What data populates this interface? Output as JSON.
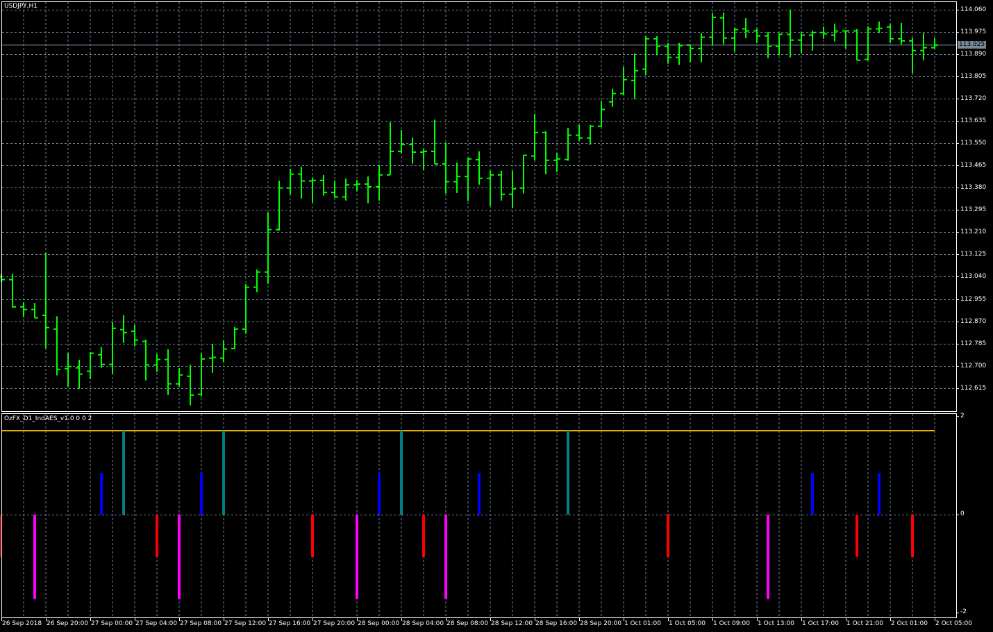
{
  "header": {
    "symbol_label": "USDJPY,H1"
  },
  "indicator": {
    "label": "OzFX_D1_IndAES_v1.0 0 0 2",
    "axis_labels": [
      "2",
      "0",
      "-2"
    ],
    "axis_values": [
      2,
      0,
      -2
    ],
    "level_line": 1.71,
    "colors": {
      "level": "#FFC000",
      "teal": "#008080",
      "blue": "#0000FF",
      "red": "#FF0000",
      "magenta": "#FF00FF"
    },
    "bars": [
      {
        "i": 0,
        "v": -0.86,
        "color": "red"
      },
      {
        "i": 3,
        "v": -1.72,
        "color": "magenta"
      },
      {
        "i": 9,
        "v": 0.85,
        "color": "blue"
      },
      {
        "i": 11,
        "v": 1.71,
        "color": "teal"
      },
      {
        "i": 14,
        "v": -0.86,
        "color": "red"
      },
      {
        "i": 16,
        "v": -1.72,
        "color": "magenta"
      },
      {
        "i": 18,
        "v": 0.85,
        "color": "blue"
      },
      {
        "i": 20,
        "v": 1.71,
        "color": "teal"
      },
      {
        "i": 28,
        "v": -0.86,
        "color": "red"
      },
      {
        "i": 32,
        "v": -1.72,
        "color": "magenta"
      },
      {
        "i": 34,
        "v": 0.85,
        "color": "blue"
      },
      {
        "i": 36,
        "v": 1.71,
        "color": "teal"
      },
      {
        "i": 38,
        "v": -0.86,
        "color": "red"
      },
      {
        "i": 40,
        "v": -1.72,
        "color": "magenta"
      },
      {
        "i": 43,
        "v": 0.85,
        "color": "blue"
      },
      {
        "i": 51,
        "v": 1.71,
        "color": "teal"
      },
      {
        "i": 60,
        "v": -0.86,
        "color": "red"
      },
      {
        "i": 69,
        "v": -1.72,
        "color": "magenta"
      },
      {
        "i": 73,
        "v": 0.85,
        "color": "blue"
      },
      {
        "i": 77,
        "v": -0.86,
        "color": "red"
      },
      {
        "i": 79,
        "v": 0.85,
        "color": "blue"
      },
      {
        "i": 82,
        "v": -0.86,
        "color": "red"
      }
    ]
  },
  "price_axis": {
    "labels": [
      "114.060",
      "113.975",
      "113.890",
      "113.805",
      "113.720",
      "113.635",
      "113.550",
      "113.465",
      "113.380",
      "113.295",
      "113.210",
      "113.125",
      "113.040",
      "112.955",
      "112.870",
      "112.785",
      "112.700",
      "112.615"
    ],
    "current_price": "113.925"
  },
  "time_axis": {
    "labels": [
      "26 Sep 2018",
      "26 Sep 20:00",
      "27 Sep 00:00",
      "27 Sep 04:00",
      "27 Sep 08:00",
      "27 Sep 12:00",
      "27 Sep 16:00",
      "27 Sep 20:00",
      "28 Sep 00:00",
      "28 Sep 04:00",
      "28 Sep 08:00",
      "28 Sep 12:00",
      "28 Sep 16:00",
      "28 Sep 20:00",
      "1 Oct 01:00",
      "1 Oct 05:00",
      "1 Oct 09:00",
      "1 Oct 13:00",
      "1 Oct 17:00",
      "1 Oct 21:00",
      "2 Oct 01:00",
      "2 Oct 05:00"
    ]
  },
  "colors": {
    "bars": "#00FF00",
    "grid": "#778899",
    "frame": "#FFFFFF",
    "price_line": "#778899"
  },
  "chart_data": {
    "type": "ohlc",
    "title": "USDJPY,H1",
    "ylim": [
      112.59,
      114.07
    ],
    "bars_ohlc": [
      [
        113.04,
        113.052,
        113.02,
        113.029
      ],
      [
        113.029,
        113.052,
        112.922,
        112.925
      ],
      [
        112.925,
        112.943,
        112.885,
        112.915
      ],
      [
        112.915,
        112.94,
        112.882,
        112.883
      ],
      [
        112.893,
        113.131,
        112.766,
        112.846
      ],
      [
        112.84,
        112.889,
        112.663,
        112.686
      ],
      [
        112.689,
        112.749,
        112.62,
        112.697
      ],
      [
        112.692,
        112.723,
        112.612,
        112.668
      ],
      [
        112.679,
        112.752,
        112.649,
        112.748
      ],
      [
        112.742,
        112.771,
        112.692,
        112.705
      ],
      [
        112.705,
        112.868,
        112.668,
        112.843
      ],
      [
        112.838,
        112.893,
        112.787,
        112.827
      ],
      [
        112.832,
        112.856,
        112.774,
        112.798
      ],
      [
        112.793,
        112.8,
        112.644,
        112.703
      ],
      [
        112.703,
        112.744,
        112.676,
        112.724
      ],
      [
        112.724,
        112.763,
        112.588,
        112.631
      ],
      [
        112.631,
        112.691,
        112.62,
        112.665
      ],
      [
        112.66,
        112.704,
        112.549,
        112.588
      ],
      [
        112.591,
        112.747,
        112.583,
        112.726
      ],
      [
        112.729,
        112.784,
        112.673,
        112.732
      ],
      [
        112.729,
        112.797,
        112.713,
        112.764
      ],
      [
        112.766,
        112.848,
        112.764,
        112.84
      ],
      [
        112.84,
        113.012,
        112.822,
        113.0
      ],
      [
        113.0,
        113.068,
        112.981,
        113.058
      ],
      [
        113.058,
        113.285,
        113.013,
        113.22
      ],
      [
        113.22,
        113.407,
        113.216,
        113.379
      ],
      [
        113.379,
        113.452,
        113.354,
        113.432
      ],
      [
        113.432,
        113.46,
        113.338,
        113.406
      ],
      [
        113.406,
        113.418,
        113.323,
        113.408
      ],
      [
        113.408,
        113.429,
        113.35,
        113.362
      ],
      [
        113.362,
        113.407,
        113.342,
        113.345
      ],
      [
        113.345,
        113.415,
        113.331,
        113.391
      ],
      [
        113.391,
        113.41,
        113.366,
        113.394
      ],
      [
        113.394,
        113.423,
        113.321,
        113.384
      ],
      [
        113.384,
        113.468,
        113.331,
        113.429
      ],
      [
        113.429,
        113.63,
        113.429,
        113.519
      ],
      [
        113.519,
        113.601,
        113.512,
        113.545
      ],
      [
        113.545,
        113.572,
        113.472,
        113.516
      ],
      [
        113.516,
        113.529,
        113.448,
        113.519
      ],
      [
        113.519,
        113.64,
        113.471,
        113.471
      ],
      [
        113.471,
        113.553,
        113.358,
        113.403
      ],
      [
        113.403,
        113.476,
        113.36,
        113.423
      ],
      [
        113.423,
        113.495,
        113.329,
        113.49
      ],
      [
        113.487,
        113.519,
        113.392,
        113.416
      ],
      [
        113.416,
        113.445,
        113.31,
        113.429
      ],
      [
        113.429,
        113.445,
        113.331,
        113.355
      ],
      [
        113.355,
        113.445,
        113.302,
        113.376
      ],
      [
        113.379,
        113.506,
        113.358,
        113.504
      ],
      [
        113.501,
        113.662,
        113.485,
        113.591
      ],
      [
        113.591,
        113.596,
        113.432,
        113.485
      ],
      [
        113.485,
        113.512,
        113.44,
        113.49
      ],
      [
        113.488,
        113.609,
        113.483,
        113.581
      ],
      [
        113.581,
        113.62,
        113.559,
        113.57
      ],
      [
        113.57,
        113.62,
        113.544,
        113.615
      ],
      [
        113.615,
        113.712,
        113.612,
        113.679
      ],
      [
        113.708,
        113.758,
        113.689,
        113.74
      ],
      [
        113.74,
        113.842,
        113.734,
        113.793
      ],
      [
        113.79,
        113.893,
        113.719,
        113.827
      ],
      [
        113.833,
        113.959,
        113.809,
        113.949
      ],
      [
        113.949,
        113.959,
        113.886,
        113.92
      ],
      [
        113.92,
        113.933,
        113.854,
        113.878
      ],
      [
        113.878,
        113.933,
        113.849,
        113.923
      ],
      [
        113.925,
        113.925,
        113.859,
        113.912
      ],
      [
        113.912,
        113.97,
        113.859,
        113.955
      ],
      [
        113.955,
        114.047,
        113.923,
        114.031
      ],
      [
        114.029,
        114.049,
        113.928,
        113.952
      ],
      [
        113.952,
        113.991,
        113.899,
        113.984
      ],
      [
        113.987,
        114.028,
        113.952,
        113.979
      ],
      [
        113.979,
        113.988,
        113.933,
        113.96
      ],
      [
        113.96,
        113.975,
        113.875,
        113.92
      ],
      [
        113.92,
        113.97,
        113.886,
        113.966
      ],
      [
        113.966,
        114.061,
        113.878,
        113.944
      ],
      [
        113.944,
        113.975,
        113.894,
        113.963
      ],
      [
        113.963,
        113.98,
        113.904,
        113.973
      ],
      [
        113.973,
        113.996,
        113.949,
        113.968
      ],
      [
        113.963,
        114.007,
        113.939,
        113.979
      ],
      [
        113.979,
        113.98,
        113.912,
        113.979
      ],
      [
        113.979,
        113.986,
        113.867,
        113.867
      ],
      [
        113.87,
        113.996,
        113.867,
        113.987
      ],
      [
        113.987,
        114.015,
        113.971,
        113.989
      ],
      [
        113.994,
        114.007,
        113.933,
        113.949
      ],
      [
        113.949,
        114.01,
        113.928,
        113.941
      ],
      [
        113.941,
        113.952,
        113.817,
        113.904
      ],
      [
        113.904,
        113.97,
        113.867,
        113.915
      ],
      [
        113.915,
        113.952,
        113.91,
        113.925
      ]
    ]
  }
}
